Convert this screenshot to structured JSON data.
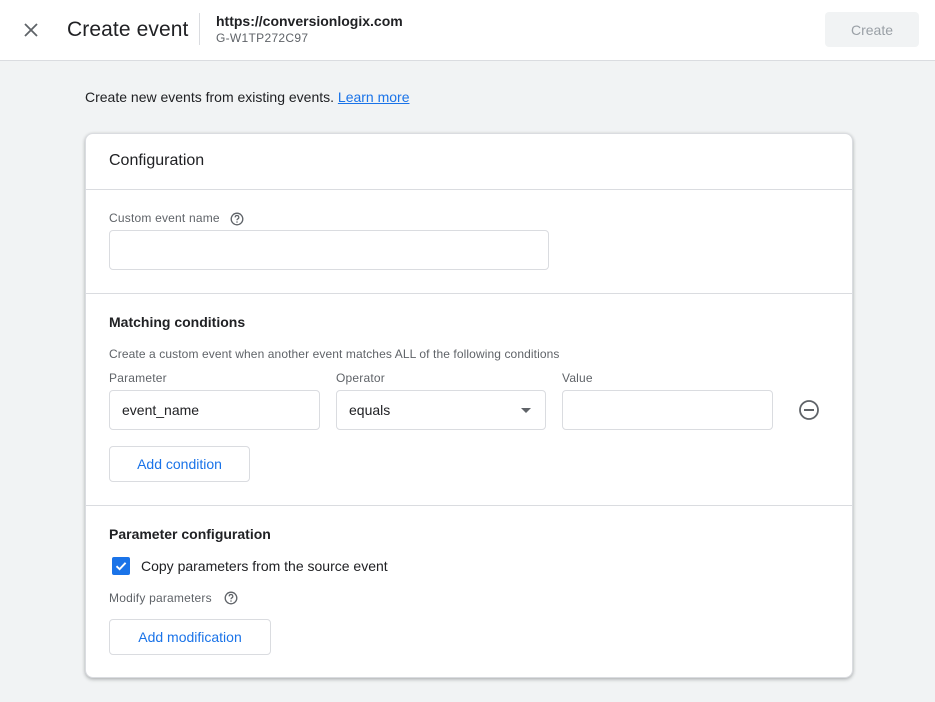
{
  "header": {
    "close_icon": "close-icon",
    "title": "Create event",
    "property_url": "https://conversionlogix.com",
    "property_id": "G-W1TP272C97",
    "create_label": "Create"
  },
  "intro": {
    "text": "Create new events from existing events. ",
    "link_label": "Learn more"
  },
  "card": {
    "title": "Configuration",
    "custom_event": {
      "label": "Custom event name",
      "value": "",
      "help_icon": "help-circle-icon"
    },
    "matching": {
      "title": "Matching conditions",
      "description": "Create a custom event when another event matches ALL of the following conditions",
      "columns": {
        "parameter": "Parameter",
        "operator": "Operator",
        "value": "Value"
      },
      "conditions": [
        {
          "parameter": "event_name",
          "operator": "equals",
          "value": ""
        }
      ],
      "remove_icon": "remove-circle-icon",
      "add_condition_label": "Add condition"
    },
    "parameter_config": {
      "title": "Parameter configuration",
      "copy_checkbox_label": "Copy parameters from the source event",
      "copy_checked": true,
      "modify_label": "Modify parameters",
      "add_modification_label": "Add modification"
    }
  },
  "colors": {
    "accent": "#1a73e8",
    "background": "#f1f3f4",
    "border": "#dadce0",
    "text_primary": "#202124",
    "text_secondary": "#5f6368"
  }
}
